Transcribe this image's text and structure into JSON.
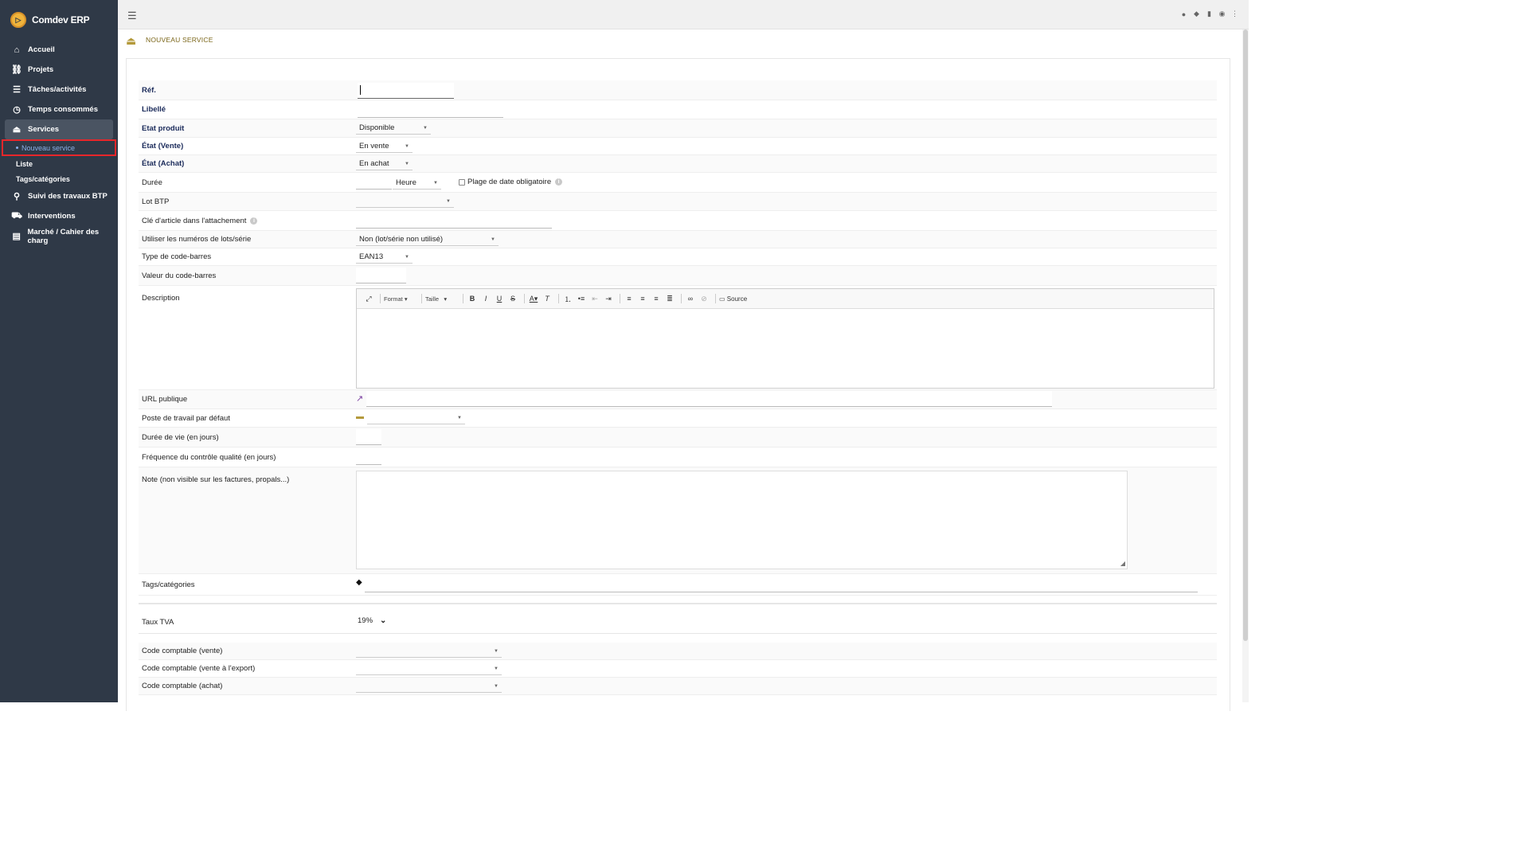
{
  "app": {
    "name": "Comdev ERP"
  },
  "sidebar": {
    "items": [
      {
        "label": "Accueil",
        "icon": "home-icon"
      },
      {
        "label": "Projets",
        "icon": "project-icon"
      },
      {
        "label": "Tâches/activités",
        "icon": "tasks-icon"
      },
      {
        "label": "Temps consommés",
        "icon": "clock-icon"
      },
      {
        "label": "Services",
        "icon": "service-bell-icon"
      },
      {
        "label": "Suivi des travaux BTP",
        "icon": "binoculars-icon"
      },
      {
        "label": "Interventions",
        "icon": "truck-icon"
      },
      {
        "label": "Marché / Cahier des charg",
        "icon": "book-icon"
      }
    ],
    "sub_items": [
      "Nouveau service",
      "Liste",
      "Tags/catégories"
    ]
  },
  "page": {
    "title": "NOUVEAU SERVICE"
  },
  "form": {
    "ref": {
      "label": "Réf.",
      "value": ""
    },
    "libelle": {
      "label": "Libellé",
      "value": ""
    },
    "etat_produit": {
      "label": "Etat produit",
      "value": "Disponible"
    },
    "etat_vente": {
      "label": "État (Vente)",
      "value": "En vente"
    },
    "etat_achat": {
      "label": "État (Achat)",
      "value": "En achat"
    },
    "duree": {
      "label": "Durée",
      "unit": "Heure",
      "checkbox_label": "Plage de date obligatoire"
    },
    "lot_btp": {
      "label": "Lot BTP",
      "value": ""
    },
    "cle_article": {
      "label": "Clé d'article dans l'attachement"
    },
    "lots_serie": {
      "label": "Utiliser les numéros de lots/série",
      "value": "Non (lot/série non utilisé)"
    },
    "type_code_barres": {
      "label": "Type de code-barres",
      "value": "EAN13"
    },
    "valeur_code_barres": {
      "label": "Valeur du code-barres"
    },
    "description": {
      "label": "Description",
      "toolbar": {
        "format": "Format",
        "taille": "Taille",
        "source": "Source"
      }
    },
    "url_publique": {
      "label": "URL publique"
    },
    "poste_travail": {
      "label": "Poste de travail par défaut"
    },
    "duree_vie": {
      "label": "Durée de vie (en jours)"
    },
    "frequence_controle": {
      "label": "Fréquence du contrôle qualité (en jours)"
    },
    "note": {
      "label": "Note (non visible sur les factures, propals...)"
    },
    "tags": {
      "label": "Tags/catégories"
    },
    "taux_tva": {
      "label": "Taux TVA",
      "value": "19%"
    },
    "code_vente": {
      "label": "Code comptable (vente)"
    },
    "code_vente_export": {
      "label": "Code comptable (vente à l'export)"
    },
    "code_achat": {
      "label": "Code comptable (achat)"
    }
  }
}
